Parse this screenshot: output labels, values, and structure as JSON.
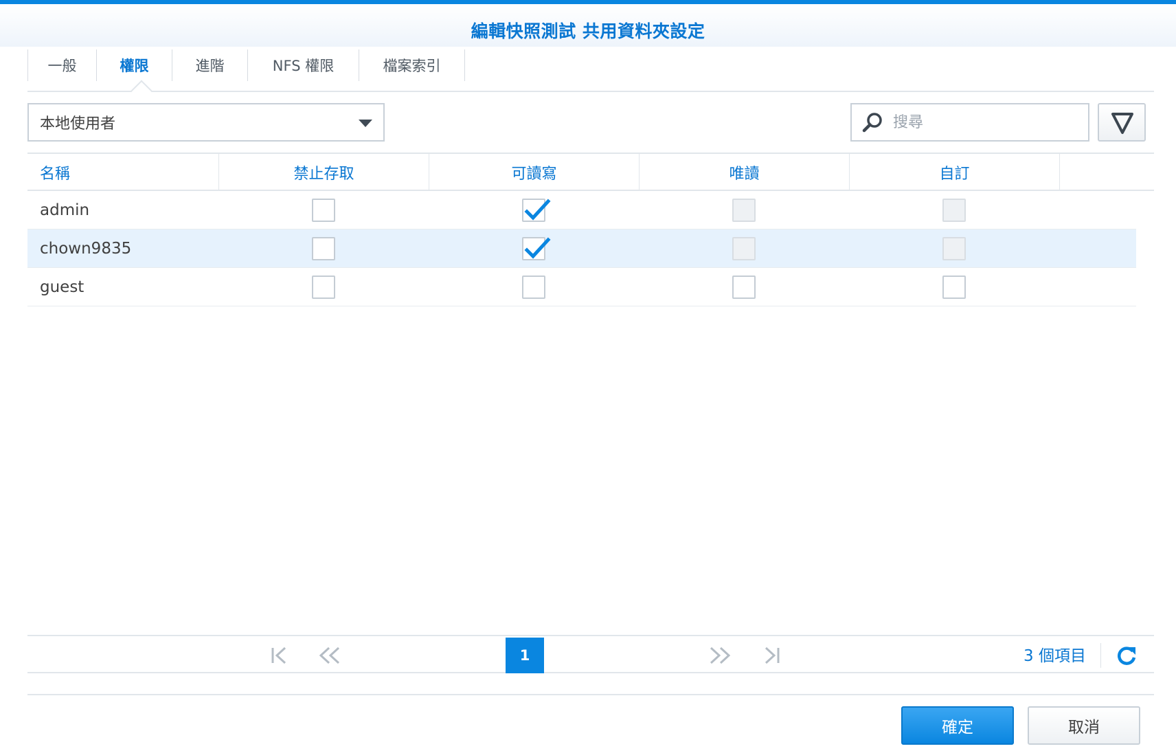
{
  "window": {
    "title": "編輯快照測試 共用資料夾設定"
  },
  "tabs": [
    {
      "label": "一般",
      "active": false
    },
    {
      "label": "權限",
      "active": true
    },
    {
      "label": "進階",
      "active": false
    },
    {
      "label": "NFS 權限",
      "active": false
    },
    {
      "label": "檔案索引",
      "active": false
    }
  ],
  "user_type_select": {
    "value": "本地使用者"
  },
  "search": {
    "placeholder": "搜尋",
    "value": ""
  },
  "table": {
    "columns": [
      "名稱",
      "禁止存取",
      "可讀寫",
      "唯讀",
      "自訂"
    ],
    "rows": [
      {
        "name": "admin",
        "deny": false,
        "read_write": true,
        "read_only": false,
        "custom": false,
        "read_only_disabled": true,
        "custom_disabled": true,
        "selected": false
      },
      {
        "name": "chown9835",
        "deny": false,
        "read_write": true,
        "read_only": false,
        "custom": false,
        "read_only_disabled": true,
        "custom_disabled": true,
        "selected": true
      },
      {
        "name": "guest",
        "deny": false,
        "read_write": false,
        "read_only": false,
        "custom": false,
        "read_only_disabled": false,
        "custom_disabled": false,
        "selected": false
      }
    ]
  },
  "pager": {
    "current_page": "1",
    "item_count": "3 個項目"
  },
  "footer": {
    "ok_label": "確定",
    "cancel_label": "取消"
  },
  "colors": {
    "accent": "#0a86e0",
    "accent_text": "#0a77d2",
    "selected_row": "#e6f2fd"
  },
  "icons": {
    "search": "search-icon",
    "filter": "filter-icon",
    "first_page": "first-page-icon",
    "prev_page": "prev-page-icon",
    "next_page": "next-page-icon",
    "last_page": "last-page-icon",
    "refresh": "refresh-icon",
    "checkmark": "checkmark-icon"
  }
}
